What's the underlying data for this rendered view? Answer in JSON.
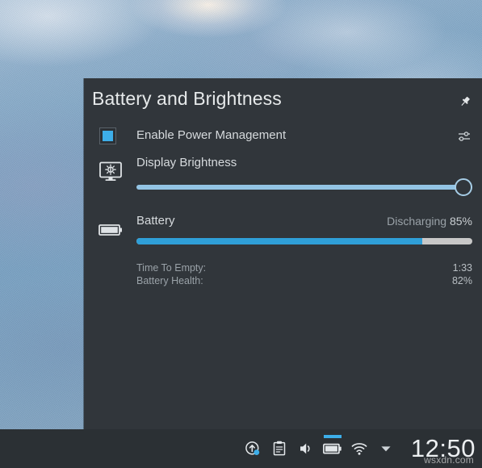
{
  "popup": {
    "title": "Battery and Brightness",
    "pin_icon": "pin-icon",
    "power_management": {
      "label": "Enable Power Management",
      "checked": true,
      "checkbox_color": "#3daee9",
      "config_icon": "configure-sliders-icon"
    },
    "brightness": {
      "label": "Display Brightness",
      "icon": "display-brightness-icon",
      "value": 100,
      "fill_color": "#93c4e4"
    },
    "battery": {
      "label": "Battery",
      "icon": "battery-icon",
      "status": "Discharging",
      "percent": "85%",
      "percent_value": 85,
      "fill_color": "#2f9fd8",
      "track_color": "#c8c8c8",
      "details": [
        {
          "label": "Time To Empty:",
          "value": "1:33"
        },
        {
          "label": "Battery Health:",
          "value": "82%"
        }
      ]
    },
    "background_color": "#31363b"
  },
  "taskbar": {
    "background_color": "#2b3034",
    "tray_icons": [
      {
        "name": "software-update-icon",
        "active": false
      },
      {
        "name": "clipboard-icon",
        "active": false
      },
      {
        "name": "volume-icon",
        "active": false
      },
      {
        "name": "battery-tray-icon",
        "active": true
      },
      {
        "name": "wifi-icon",
        "active": false
      },
      {
        "name": "chevron-down-icon",
        "active": false
      }
    ],
    "clock": "12:50",
    "accent_color": "#3daee9"
  },
  "watermark": "wsxdn.com"
}
